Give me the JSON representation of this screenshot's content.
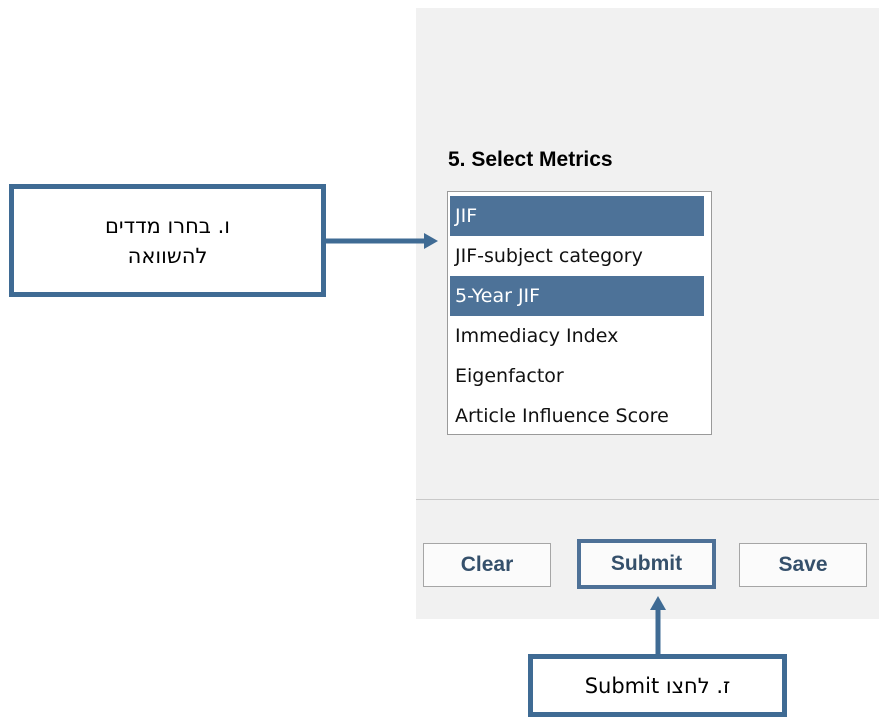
{
  "metrics_section": {
    "title": "5. Select Metrics",
    "options": [
      {
        "label": "JIF",
        "selected": true
      },
      {
        "label": "JIF-subject category",
        "selected": false
      },
      {
        "label": "5-Year JIF",
        "selected": true
      },
      {
        "label": "Immediacy Index",
        "selected": false
      },
      {
        "label": "Eigenfactor",
        "selected": false
      },
      {
        "label": "Article Influence Score",
        "selected": false
      }
    ]
  },
  "actions": {
    "clear_label": "Clear",
    "submit_label": "Submit",
    "save_label": "Save"
  },
  "annotations": {
    "metrics_callout_line1": "ו. בחרו מדדים",
    "metrics_callout_line2": "להשוואה",
    "submit_callout": "ז. לחצו Submit"
  },
  "colors": {
    "selected_bg": "#4d7298",
    "callout_border": "#3f6b94",
    "button_text": "#35506b",
    "panel_bg": "#f1f1f1"
  }
}
